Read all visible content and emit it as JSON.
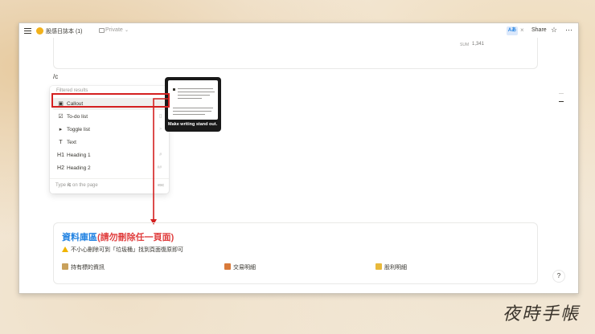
{
  "topbar": {
    "page_title": "股感日誌本 (1)",
    "privacy": "Private",
    "font_badge": "Aあ",
    "close_glyph": "×",
    "share_label": "Share",
    "star_icon": "☆",
    "more_icon": "⋯"
  },
  "sum_card": {
    "label": "SUM",
    "value": "1,341"
  },
  "editor": {
    "slash_text": "/c"
  },
  "command_menu": {
    "header": "Filtered results",
    "items": [
      {
        "icon": "callout-icon",
        "glyph": "▣",
        "label": "Callout",
        "hint": "",
        "selected": true
      },
      {
        "icon": "todo-list-icon",
        "glyph": "☑",
        "label": "To-do list",
        "hint": "[]"
      },
      {
        "icon": "toggle-list-icon",
        "glyph": "▸",
        "label": "Toggle list",
        "hint": ">"
      },
      {
        "icon": "text-icon",
        "glyph": "T",
        "label": "Text",
        "hint": ""
      },
      {
        "icon": "heading1-icon",
        "glyph": "H1",
        "label": "Heading 1",
        "hint": "#"
      },
      {
        "icon": "heading2-icon",
        "glyph": "H2",
        "label": "Heading 2",
        "hint": "##"
      }
    ],
    "footer_prefix": "Type",
    "footer_query": "/c",
    "footer_suffix": "on the page",
    "esc_label": "esc"
  },
  "preview": {
    "caption": "Make writing stand out."
  },
  "database": {
    "title_part1": "資料庫區",
    "title_part2": "(請勿刪除任一頁面)",
    "warning": "不小心刪除可到「垃圾桶」找到頁面復原即可",
    "links": [
      {
        "icon": "memo-icon",
        "color": "#c9a15c",
        "label": "持有標的資訊"
      },
      {
        "icon": "stack-icon",
        "color": "#d97a3a",
        "label": "交易明細"
      },
      {
        "icon": "moneybag-icon",
        "color": "#e8b93b",
        "label": "股利明細"
      }
    ]
  },
  "help_button": "?",
  "watermark": "夜時手帳"
}
